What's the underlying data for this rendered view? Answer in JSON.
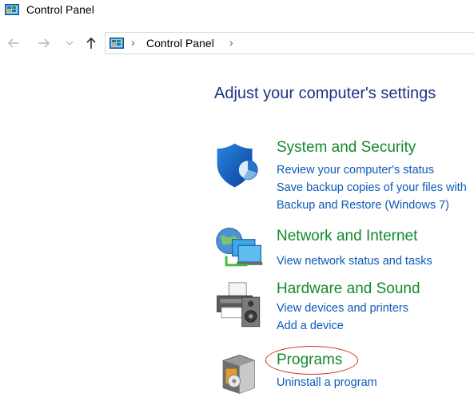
{
  "window": {
    "title": "Control Panel"
  },
  "navigation": {
    "back_icon": "back-arrow-icon",
    "forward_icon": "forward-arrow-icon",
    "recent_icon": "chevron-down-icon",
    "up_icon": "up-arrow-icon",
    "breadcrumb": [
      "Control Panel"
    ],
    "separator": "›"
  },
  "main": {
    "heading": "Adjust your computer's settings",
    "categories": [
      {
        "title": "System and Security",
        "icon": "shield-icon",
        "links": [
          "Review your computer's status",
          "Save backup copies of your files with",
          "Backup and Restore (Windows 7)"
        ]
      },
      {
        "title": "Network and Internet",
        "icon": "network-globe-icon",
        "links": [
          "View network status and tasks"
        ]
      },
      {
        "title": "Hardware and Sound",
        "icon": "printer-speaker-icon",
        "links": [
          "View devices and printers",
          "Add a device"
        ]
      },
      {
        "title": "Programs",
        "icon": "programs-box-icon",
        "highlighted": true,
        "links": [
          "Uninstall a program"
        ]
      }
    ]
  },
  "colors": {
    "heading": "#1e3287",
    "category_title": "#138a2a",
    "link": "#0b5ab8",
    "annotation": "#d42a2a"
  }
}
